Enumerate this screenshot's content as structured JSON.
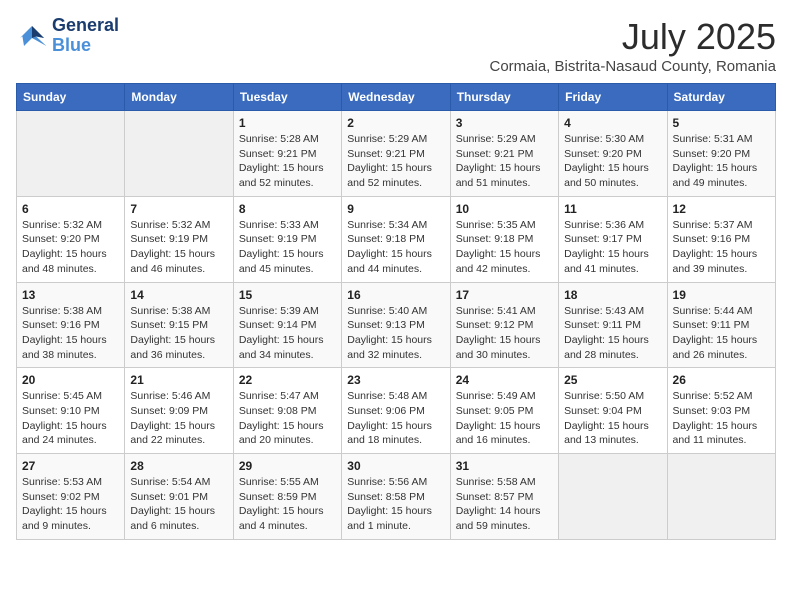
{
  "logo": {
    "line1": "General",
    "line2": "Blue"
  },
  "title": "July 2025",
  "subtitle": "Cormaia, Bistrita-Nasaud County, Romania",
  "weekdays": [
    "Sunday",
    "Monday",
    "Tuesday",
    "Wednesday",
    "Thursday",
    "Friday",
    "Saturday"
  ],
  "weeks": [
    [
      {
        "day": "",
        "info": ""
      },
      {
        "day": "",
        "info": ""
      },
      {
        "day": "1",
        "info": "Sunrise: 5:28 AM\nSunset: 9:21 PM\nDaylight: 15 hours\nand 52 minutes."
      },
      {
        "day": "2",
        "info": "Sunrise: 5:29 AM\nSunset: 9:21 PM\nDaylight: 15 hours\nand 52 minutes."
      },
      {
        "day": "3",
        "info": "Sunrise: 5:29 AM\nSunset: 9:21 PM\nDaylight: 15 hours\nand 51 minutes."
      },
      {
        "day": "4",
        "info": "Sunrise: 5:30 AM\nSunset: 9:20 PM\nDaylight: 15 hours\nand 50 minutes."
      },
      {
        "day": "5",
        "info": "Sunrise: 5:31 AM\nSunset: 9:20 PM\nDaylight: 15 hours\nand 49 minutes."
      }
    ],
    [
      {
        "day": "6",
        "info": "Sunrise: 5:32 AM\nSunset: 9:20 PM\nDaylight: 15 hours\nand 48 minutes."
      },
      {
        "day": "7",
        "info": "Sunrise: 5:32 AM\nSunset: 9:19 PM\nDaylight: 15 hours\nand 46 minutes."
      },
      {
        "day": "8",
        "info": "Sunrise: 5:33 AM\nSunset: 9:19 PM\nDaylight: 15 hours\nand 45 minutes."
      },
      {
        "day": "9",
        "info": "Sunrise: 5:34 AM\nSunset: 9:18 PM\nDaylight: 15 hours\nand 44 minutes."
      },
      {
        "day": "10",
        "info": "Sunrise: 5:35 AM\nSunset: 9:18 PM\nDaylight: 15 hours\nand 42 minutes."
      },
      {
        "day": "11",
        "info": "Sunrise: 5:36 AM\nSunset: 9:17 PM\nDaylight: 15 hours\nand 41 minutes."
      },
      {
        "day": "12",
        "info": "Sunrise: 5:37 AM\nSunset: 9:16 PM\nDaylight: 15 hours\nand 39 minutes."
      }
    ],
    [
      {
        "day": "13",
        "info": "Sunrise: 5:38 AM\nSunset: 9:16 PM\nDaylight: 15 hours\nand 38 minutes."
      },
      {
        "day": "14",
        "info": "Sunrise: 5:38 AM\nSunset: 9:15 PM\nDaylight: 15 hours\nand 36 minutes."
      },
      {
        "day": "15",
        "info": "Sunrise: 5:39 AM\nSunset: 9:14 PM\nDaylight: 15 hours\nand 34 minutes."
      },
      {
        "day": "16",
        "info": "Sunrise: 5:40 AM\nSunset: 9:13 PM\nDaylight: 15 hours\nand 32 minutes."
      },
      {
        "day": "17",
        "info": "Sunrise: 5:41 AM\nSunset: 9:12 PM\nDaylight: 15 hours\nand 30 minutes."
      },
      {
        "day": "18",
        "info": "Sunrise: 5:43 AM\nSunset: 9:11 PM\nDaylight: 15 hours\nand 28 minutes."
      },
      {
        "day": "19",
        "info": "Sunrise: 5:44 AM\nSunset: 9:11 PM\nDaylight: 15 hours\nand 26 minutes."
      }
    ],
    [
      {
        "day": "20",
        "info": "Sunrise: 5:45 AM\nSunset: 9:10 PM\nDaylight: 15 hours\nand 24 minutes."
      },
      {
        "day": "21",
        "info": "Sunrise: 5:46 AM\nSunset: 9:09 PM\nDaylight: 15 hours\nand 22 minutes."
      },
      {
        "day": "22",
        "info": "Sunrise: 5:47 AM\nSunset: 9:08 PM\nDaylight: 15 hours\nand 20 minutes."
      },
      {
        "day": "23",
        "info": "Sunrise: 5:48 AM\nSunset: 9:06 PM\nDaylight: 15 hours\nand 18 minutes."
      },
      {
        "day": "24",
        "info": "Sunrise: 5:49 AM\nSunset: 9:05 PM\nDaylight: 15 hours\nand 16 minutes."
      },
      {
        "day": "25",
        "info": "Sunrise: 5:50 AM\nSunset: 9:04 PM\nDaylight: 15 hours\nand 13 minutes."
      },
      {
        "day": "26",
        "info": "Sunrise: 5:52 AM\nSunset: 9:03 PM\nDaylight: 15 hours\nand 11 minutes."
      }
    ],
    [
      {
        "day": "27",
        "info": "Sunrise: 5:53 AM\nSunset: 9:02 PM\nDaylight: 15 hours\nand 9 minutes."
      },
      {
        "day": "28",
        "info": "Sunrise: 5:54 AM\nSunset: 9:01 PM\nDaylight: 15 hours\nand 6 minutes."
      },
      {
        "day": "29",
        "info": "Sunrise: 5:55 AM\nSunset: 8:59 PM\nDaylight: 15 hours\nand 4 minutes."
      },
      {
        "day": "30",
        "info": "Sunrise: 5:56 AM\nSunset: 8:58 PM\nDaylight: 15 hours\nand 1 minute."
      },
      {
        "day": "31",
        "info": "Sunrise: 5:58 AM\nSunset: 8:57 PM\nDaylight: 14 hours\nand 59 minutes."
      },
      {
        "day": "",
        "info": ""
      },
      {
        "day": "",
        "info": ""
      }
    ]
  ]
}
